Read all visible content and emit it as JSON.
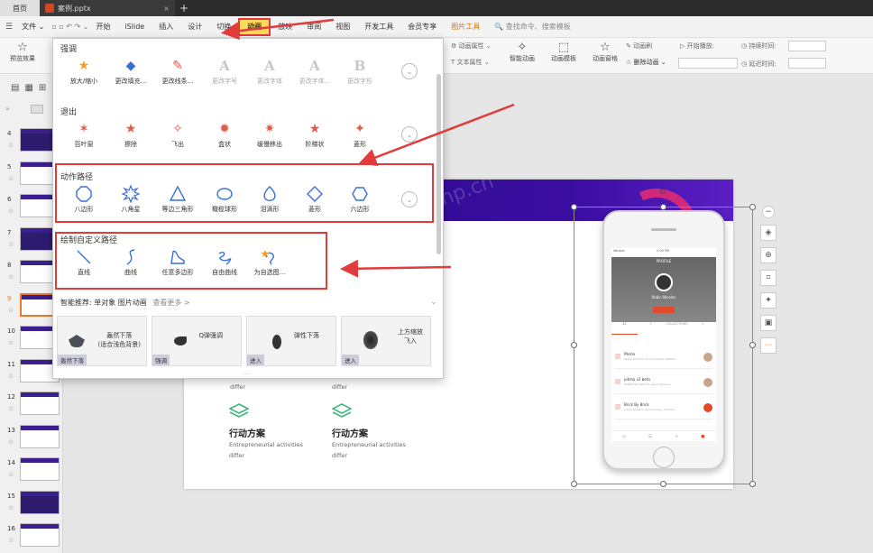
{
  "titlebar": {
    "home_tab": "首页",
    "doc_tab": "案例.pptx",
    "close": "×",
    "add": "+"
  },
  "menu": {
    "items": [
      "文件",
      "开始",
      "iSlide",
      "插入",
      "设计",
      "切换",
      "动画",
      "放映",
      "审阅",
      "视图",
      "开发工具",
      "会员专享",
      "图片工具"
    ],
    "active": "动画",
    "search": "查找命令、搜索模板"
  },
  "ribbon": {
    "preview": "预览效果",
    "anim_props": "动画属性",
    "text_props": "文本属性",
    "smart_anim": "智能动画",
    "anim_template": "动画模板",
    "anim_pane": "动画窗格",
    "anim_brush": "动画刷",
    "delete_anim": "删除动画",
    "start_play": "开始播放:",
    "duration": "持续时间:",
    "delay": "延迟时间:"
  },
  "panel": {
    "sections": [
      {
        "title": "强调",
        "items": [
          {
            "label": "放大/缩小",
            "icon": "star-zoom-icon",
            "disabled": false
          },
          {
            "label": "更改填充...",
            "icon": "fill-icon",
            "disabled": false
          },
          {
            "label": "更改线条...",
            "icon": "line-color-icon",
            "disabled": false
          },
          {
            "label": "更改字号",
            "icon": "A",
            "disabled": true
          },
          {
            "label": "更改字体",
            "icon": "A",
            "disabled": true
          },
          {
            "label": "更改字体...",
            "icon": "A",
            "disabled": true
          },
          {
            "label": "更改字形",
            "icon": "B",
            "disabled": true
          }
        ]
      },
      {
        "title": "退出",
        "items": [
          {
            "label": "百叶窗",
            "icon": "blinds-star-icon"
          },
          {
            "label": "擦除",
            "icon": "wipe-star-icon"
          },
          {
            "label": "飞出",
            "icon": "fly-out-star-icon"
          },
          {
            "label": "盒状",
            "icon": "box-star-icon"
          },
          {
            "label": "缓慢移出",
            "icon": "slow-out-star-icon"
          },
          {
            "label": "阶梯状",
            "icon": "stairs-star-icon"
          },
          {
            "label": "菱形",
            "icon": "diamond-star-icon"
          }
        ]
      },
      {
        "title": "动作路径",
        "items": [
          {
            "label": "八边形",
            "icon": "octagon-path-icon"
          },
          {
            "label": "八角星",
            "icon": "star8-path-icon"
          },
          {
            "label": "等边三角形",
            "icon": "triangle-path-icon"
          },
          {
            "label": "橄榄球形",
            "icon": "football-path-icon"
          },
          {
            "label": "泪滴形",
            "icon": "teardrop-path-icon"
          },
          {
            "label": "菱形",
            "icon": "diamond-path-icon"
          },
          {
            "label": "六边形",
            "icon": "hexagon-path-icon"
          }
        ]
      },
      {
        "title": "绘制自定义路径",
        "items": [
          {
            "label": "直线",
            "icon": "line-path-icon"
          },
          {
            "label": "曲线",
            "icon": "curve-path-icon"
          },
          {
            "label": "任意多边形",
            "icon": "freeform-path-icon"
          },
          {
            "label": "自由曲线",
            "icon": "scribble-path-icon"
          },
          {
            "label": "为自选图...",
            "icon": "shape-path-icon"
          }
        ]
      }
    ],
    "smart": {
      "title": "智能推荐:",
      "subtitle": "单对象 图片动画",
      "more": "查看更多 >",
      "cards": [
        {
          "text1": "轰然下落",
          "text2": "(适合浅色背景)",
          "caption": "轰然下落"
        },
        {
          "text1": "Q弹强调",
          "text2": "",
          "caption": "强调"
        },
        {
          "text1": "弹性下落",
          "text2": "",
          "caption": "进入"
        },
        {
          "text1": "上方缩放",
          "text2": "飞入",
          "caption": "进入"
        }
      ]
    },
    "more_btn": "⌄",
    "collapse": "⌄"
  },
  "thumbs": {
    "numbers": [
      "4",
      "5",
      "6",
      "7",
      "8",
      "9",
      "10",
      "11",
      "12",
      "13",
      "14",
      "15",
      "16"
    ],
    "selected": "9"
  },
  "slide": {
    "blocks": [
      {
        "sub": "differ"
      },
      {
        "sub": "differ"
      },
      {
        "title": "行动方案",
        "desc": "Entrepreneurial activities",
        "sub": "differ"
      },
      {
        "title": "行动方案",
        "desc": "Entrepreneurial activities",
        "sub": "differ"
      }
    ],
    "watermark": "php.cn",
    "phone": {
      "status": "Verizon",
      "time": "2:00 PM",
      "header": "PROFILE",
      "name": "Robin Nicolas",
      "stats": [
        "42",
        "3",
        "COLLECTIONS",
        "1"
      ],
      "rows": [
        {
          "t1": "Pikmo",
          "t2": "Share and find your inherited patterns"
        },
        {
          "t1": "pikmo v2 beta",
          "t2": "Rubble till safari to share hyperion"
        },
        {
          "t1": "Brick By Brick",
          "t2": "A tour guide to discovering...contract"
        }
      ]
    }
  },
  "colors": {
    "accent": "#e23b3b",
    "active_tab": "#ffd95a",
    "slide_band": "#2a0b86",
    "icon_red": "#e25a4a",
    "icon_blue": "#3a6fd8",
    "green": "#3bb87a"
  }
}
